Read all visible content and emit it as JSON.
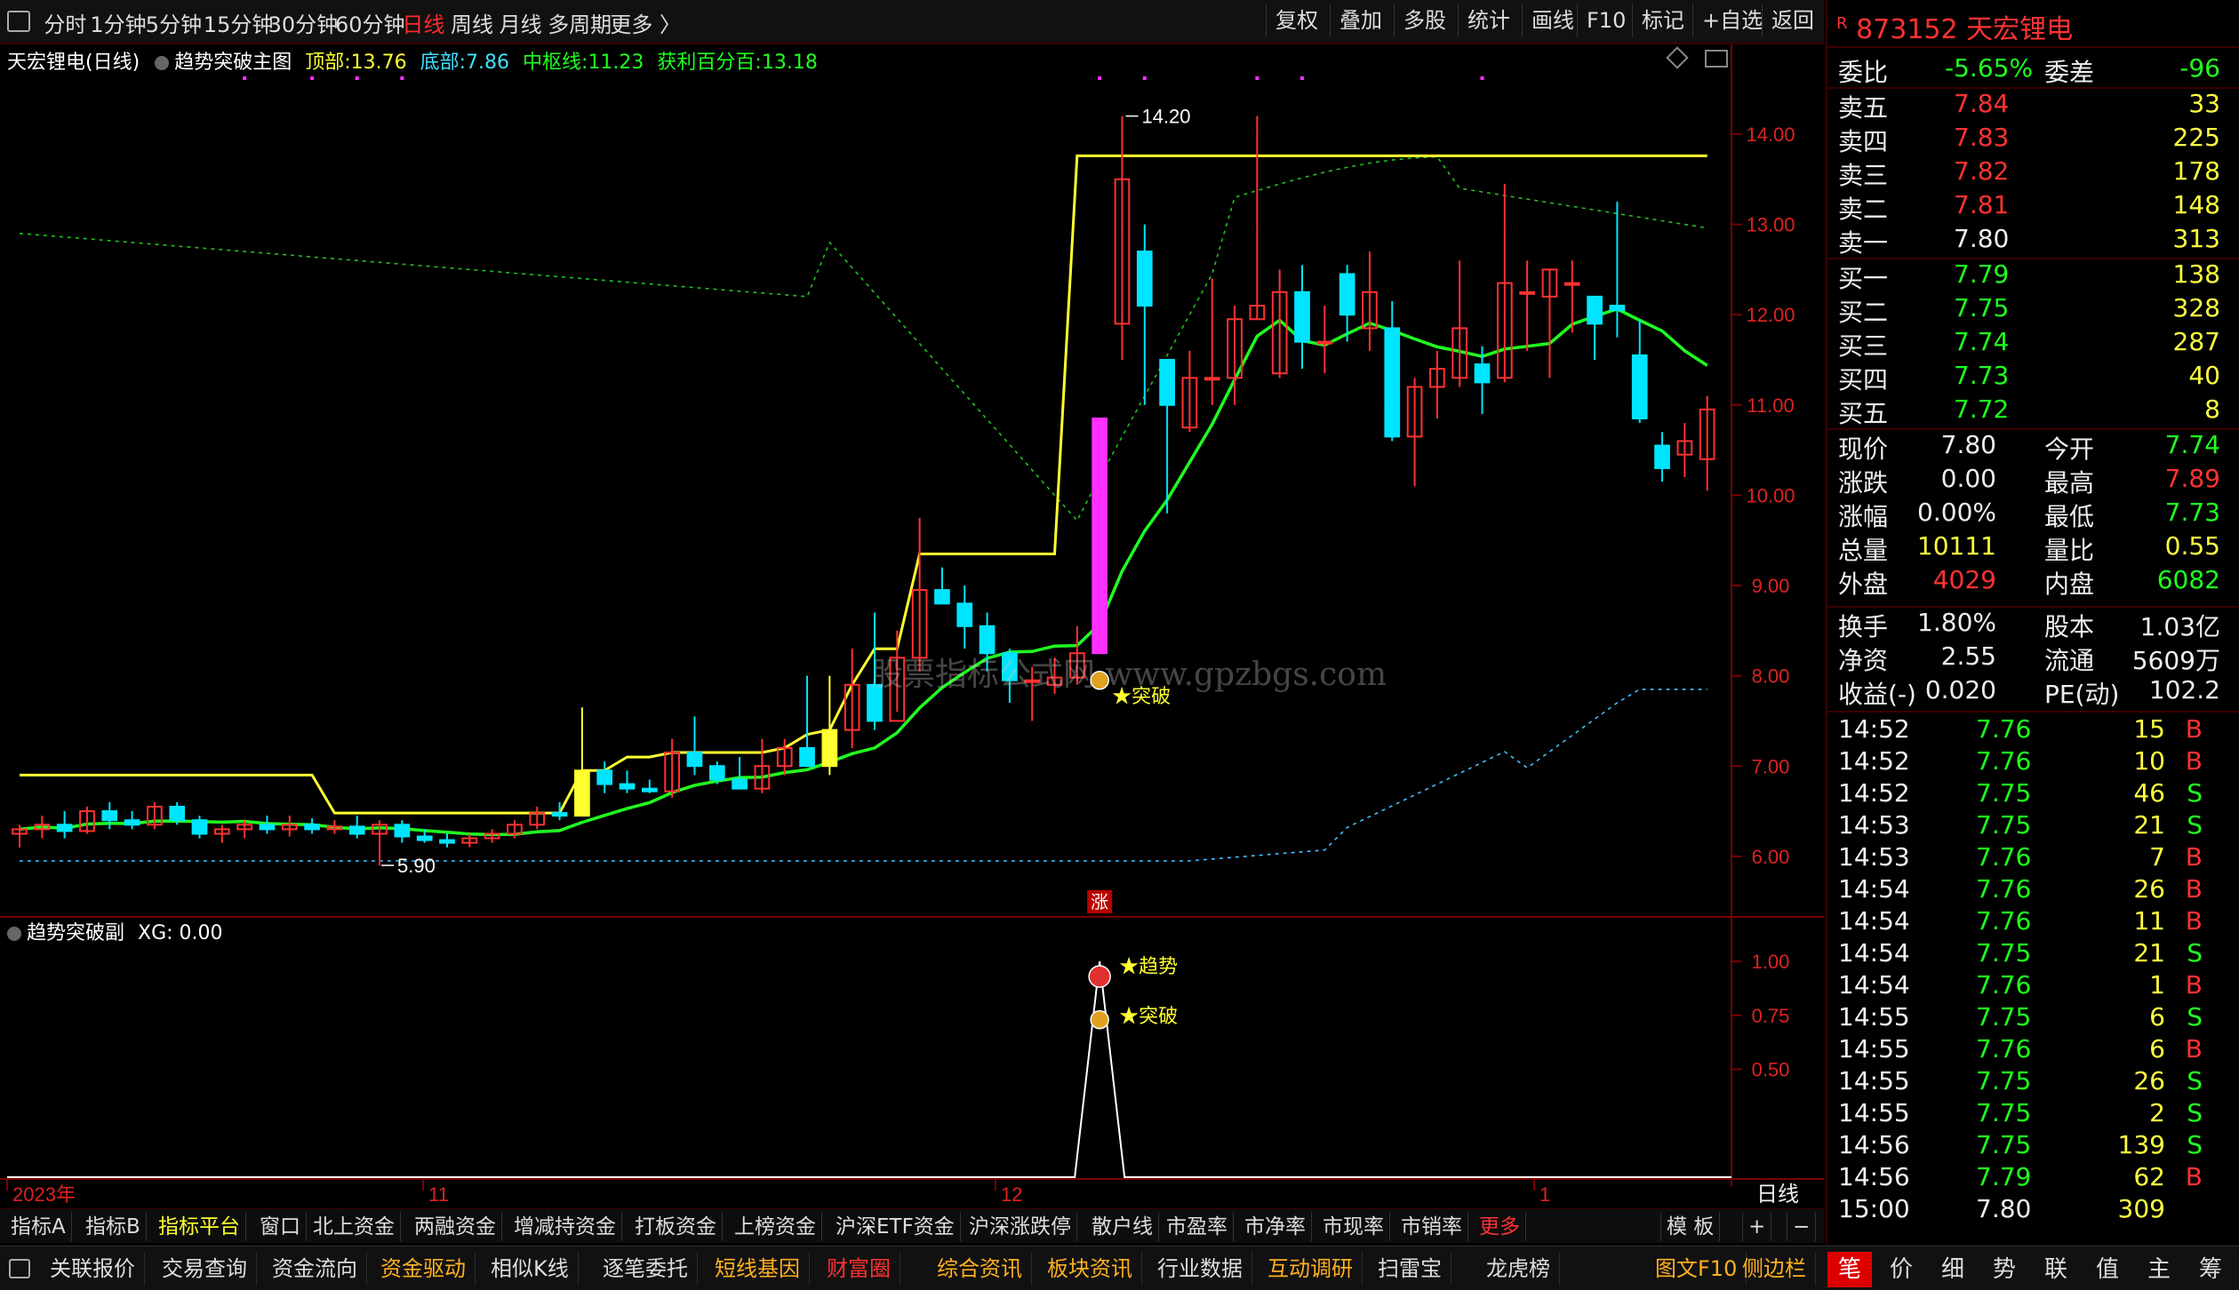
{
  "toolbar": {
    "left_items": [
      "分时",
      "1分钟",
      "5分钟",
      "15分钟",
      "30分钟",
      "60分钟",
      "日线",
      "周线",
      "月线",
      "多周期",
      "更多 〉"
    ],
    "active": "日线",
    "right_items": [
      "复权",
      "叠加",
      "多股",
      "统计",
      "画线",
      "F10",
      "标记",
      "+自选",
      "返回"
    ]
  },
  "main_legend": {
    "stock": "天宏锂电",
    "period": "(日线)",
    "indicator": "趋势突破主图",
    "top_label": "顶部:",
    "top_val": "13.76",
    "bottom_label": "底部:",
    "bottom_val": "7.86",
    "mid_label": "中枢线:",
    "mid_val": "11.23",
    "profit_label": "获利百分百:",
    "profit_val": "13.18"
  },
  "sub_legend": {
    "indicator": "趋势突破副",
    "xg": "XG: 0.00"
  },
  "annotations": {
    "high": "14.20",
    "low": "5.90",
    "breakout": "★突破",
    "trend": "★趋势",
    "breakout2": "★突破",
    "limit_up": "涨",
    "watermark": "股票指标公式网 www.gpzbgs.com"
  },
  "colors": {
    "up": "#ff3232",
    "down": "#00e5ff",
    "yellow_line": "#ffff30",
    "green_line": "#20ff20",
    "magenta": "#ff30ff"
  },
  "chart_data": {
    "type": "candlestick",
    "price_axis": [
      "14.00",
      "13.00",
      "12.00",
      "11.00",
      "10.00",
      "9.00",
      "8.00",
      "7.00",
      "6.00"
    ],
    "ylim": [
      5.3,
      14.6
    ],
    "sub_axis": [
      "1.00",
      "0.75",
      "0.50"
    ],
    "x_labels": [
      "2023年",
      "11",
      "12",
      "1"
    ],
    "period_label": "日线",
    "candles": [
      {
        "o": 6.25,
        "h": 6.35,
        "l": 6.1,
        "c": 6.3
      },
      {
        "o": 6.3,
        "h": 6.45,
        "l": 6.2,
        "c": 6.35
      },
      {
        "o": 6.35,
        "h": 6.5,
        "l": 6.2,
        "c": 6.28
      },
      {
        "o": 6.28,
        "h": 6.55,
        "l": 6.25,
        "c": 6.5
      },
      {
        "o": 6.5,
        "h": 6.6,
        "l": 6.3,
        "c": 6.4
      },
      {
        "o": 6.4,
        "h": 6.5,
        "l": 6.3,
        "c": 6.35
      },
      {
        "o": 6.35,
        "h": 6.6,
        "l": 6.3,
        "c": 6.55
      },
      {
        "o": 6.55,
        "h": 6.6,
        "l": 6.35,
        "c": 6.4
      },
      {
        "o": 6.4,
        "h": 6.45,
        "l": 6.2,
        "c": 6.25
      },
      {
        "o": 6.25,
        "h": 6.35,
        "l": 6.15,
        "c": 6.3
      },
      {
        "o": 6.3,
        "h": 6.4,
        "l": 6.2,
        "c": 6.35
      },
      {
        "o": 6.35,
        "h": 6.45,
        "l": 6.25,
        "c": 6.3
      },
      {
        "o": 6.3,
        "h": 6.45,
        "l": 6.22,
        "c": 6.35
      },
      {
        "o": 6.35,
        "h": 6.42,
        "l": 6.25,
        "c": 6.3
      },
      {
        "o": 6.3,
        "h": 6.4,
        "l": 6.25,
        "c": 6.33
      },
      {
        "o": 6.33,
        "h": 6.45,
        "l": 6.2,
        "c": 6.25
      },
      {
        "o": 6.25,
        "h": 6.4,
        "l": 5.9,
        "c": 6.35
      },
      {
        "o": 6.35,
        "h": 6.4,
        "l": 6.15,
        "c": 6.22
      },
      {
        "o": 6.22,
        "h": 6.3,
        "l": 6.15,
        "c": 6.18
      },
      {
        "o": 6.18,
        "h": 6.25,
        "l": 6.1,
        "c": 6.15
      },
      {
        "o": 6.15,
        "h": 6.25,
        "l": 6.1,
        "c": 6.2
      },
      {
        "o": 6.2,
        "h": 6.3,
        "l": 6.15,
        "c": 6.25
      },
      {
        "o": 6.25,
        "h": 6.4,
        "l": 6.2,
        "c": 6.35
      },
      {
        "o": 6.35,
        "h": 6.55,
        "l": 6.3,
        "c": 6.48
      },
      {
        "o": 6.48,
        "h": 6.6,
        "l": 6.4,
        "c": 6.45
      },
      {
        "o": 6.45,
        "h": 7.65,
        "l": 6.45,
        "c": 6.95
      },
      {
        "o": 6.95,
        "h": 7.05,
        "l": 6.7,
        "c": 6.8
      },
      {
        "o": 6.8,
        "h": 6.95,
        "l": 6.7,
        "c": 6.75
      },
      {
        "o": 6.75,
        "h": 6.85,
        "l": 6.7,
        "c": 6.72
      },
      {
        "o": 6.72,
        "h": 7.3,
        "l": 6.65,
        "c": 7.15
      },
      {
        "o": 7.15,
        "h": 7.55,
        "l": 6.9,
        "c": 7.0
      },
      {
        "o": 7.0,
        "h": 7.05,
        "l": 6.8,
        "c": 6.85
      },
      {
        "o": 6.85,
        "h": 7.1,
        "l": 6.75,
        "c": 6.75
      },
      {
        "o": 6.75,
        "h": 7.3,
        "l": 6.7,
        "c": 7.0
      },
      {
        "o": 7.0,
        "h": 7.3,
        "l": 6.9,
        "c": 7.2
      },
      {
        "o": 7.2,
        "h": 8.0,
        "l": 7.1,
        "c": 7.0
      },
      {
        "o": 7.0,
        "h": 8.0,
        "l": 6.9,
        "c": 7.4
      },
      {
        "o": 7.4,
        "h": 8.3,
        "l": 7.2,
        "c": 7.9
      },
      {
        "o": 7.9,
        "h": 8.7,
        "l": 7.4,
        "c": 7.5
      },
      {
        "o": 7.5,
        "h": 8.5,
        "l": 7.6,
        "c": 8.2
      },
      {
        "o": 8.2,
        "h": 9.75,
        "l": 8.05,
        "c": 8.95
      },
      {
        "o": 8.95,
        "h": 9.2,
        "l": 8.8,
        "c": 8.8
      },
      {
        "o": 8.8,
        "h": 9.0,
        "l": 8.3,
        "c": 8.55
      },
      {
        "o": 8.55,
        "h": 8.7,
        "l": 8.05,
        "c": 8.25
      },
      {
        "o": 8.25,
        "h": 8.3,
        "l": 7.7,
        "c": 7.95
      },
      {
        "o": 7.95,
        "h": 8.1,
        "l": 7.5,
        "c": 7.95
      },
      {
        "o": 7.9,
        "h": 8.2,
        "l": 7.8,
        "c": 7.98
      },
      {
        "o": 7.98,
        "h": 8.55,
        "l": 7.9,
        "c": 8.25
      },
      {
        "o": 8.25,
        "h": 10.85,
        "l": 8.25,
        "c": 10.85
      },
      {
        "o": 11.9,
        "h": 14.2,
        "l": 11.5,
        "c": 13.5
      },
      {
        "o": 12.7,
        "h": 13.0,
        "l": 11.0,
        "c": 12.1
      },
      {
        "o": 11.5,
        "h": 11.0,
        "l": 9.8,
        "c": 11.0
      },
      {
        "o": 10.75,
        "h": 11.6,
        "l": 10.7,
        "c": 11.3
      },
      {
        "o": 11.3,
        "h": 12.4,
        "l": 11.0,
        "c": 11.3
      },
      {
        "o": 11.3,
        "h": 12.1,
        "l": 11.0,
        "c": 11.95
      },
      {
        "o": 11.95,
        "h": 14.2,
        "l": 11.95,
        "c": 12.1
      },
      {
        "o": 11.35,
        "h": 12.5,
        "l": 11.3,
        "c": 12.25
      },
      {
        "o": 12.25,
        "h": 12.55,
        "l": 11.4,
        "c": 11.7
      },
      {
        "o": 11.7,
        "h": 12.1,
        "l": 11.35,
        "c": 11.7
      },
      {
        "o": 12.45,
        "h": 12.55,
        "l": 11.7,
        "c": 12.0
      },
      {
        "o": 11.85,
        "h": 12.7,
        "l": 11.6,
        "c": 12.25
      },
      {
        "o": 11.85,
        "h": 12.15,
        "l": 10.6,
        "c": 10.65
      },
      {
        "o": 10.65,
        "h": 11.3,
        "l": 10.1,
        "c": 11.2
      },
      {
        "o": 11.2,
        "h": 11.6,
        "l": 10.85,
        "c": 11.4
      },
      {
        "o": 11.3,
        "h": 12.6,
        "l": 11.2,
        "c": 11.85
      },
      {
        "o": 11.45,
        "h": 11.65,
        "l": 10.9,
        "c": 11.25
      },
      {
        "o": 11.3,
        "h": 13.45,
        "l": 11.25,
        "c": 12.35
      },
      {
        "o": 12.25,
        "h": 12.6,
        "l": 11.6,
        "c": 12.25
      },
      {
        "o": 12.2,
        "h": 12.5,
        "l": 11.3,
        "c": 12.5
      },
      {
        "o": 12.35,
        "h": 12.6,
        "l": 11.8,
        "c": 12.35
      },
      {
        "o": 12.2,
        "h": 12.2,
        "l": 11.5,
        "c": 11.9
      },
      {
        "o": 12.1,
        "h": 13.25,
        "l": 11.75,
        "c": 12.05
      },
      {
        "o": 11.55,
        "h": 11.95,
        "l": 10.8,
        "c": 10.85
      },
      {
        "o": 10.55,
        "h": 10.7,
        "l": 10.15,
        "c": 10.3
      },
      {
        "o": 10.45,
        "h": 10.8,
        "l": 10.2,
        "c": 10.6
      },
      {
        "o": 10.4,
        "h": 11.1,
        "l": 10.05,
        "c": 10.95
      }
    ]
  },
  "quote": {
    "code_prefix": "R",
    "code": "873152",
    "name": "天宏锂电",
    "ratio_label": "委比",
    "ratio": "-5.65%",
    "diff_label": "委差",
    "diff": "-96",
    "asks": [
      {
        "label": "卖五",
        "price": "7.84",
        "vol": "33"
      },
      {
        "label": "卖四",
        "price": "7.83",
        "vol": "225"
      },
      {
        "label": "卖三",
        "price": "7.82",
        "vol": "178"
      },
      {
        "label": "卖二",
        "price": "7.81",
        "vol": "148"
      },
      {
        "label": "卖一",
        "price": "7.80",
        "vol": "313"
      }
    ],
    "bids": [
      {
        "label": "买一",
        "price": "7.79",
        "vol": "138"
      },
      {
        "label": "买二",
        "price": "7.75",
        "vol": "328"
      },
      {
        "label": "买三",
        "price": "7.74",
        "vol": "287"
      },
      {
        "label": "买四",
        "price": "7.73",
        "vol": "40"
      },
      {
        "label": "买五",
        "price": "7.72",
        "vol": "8"
      }
    ],
    "stats": [
      {
        "k1": "现价",
        "v1": "7.80",
        "c1": "white",
        "k2": "今开",
        "v2": "7.74",
        "c2": "green"
      },
      {
        "k1": "涨跌",
        "v1": "0.00",
        "c1": "white",
        "k2": "最高",
        "v2": "7.89",
        "c2": "red"
      },
      {
        "k1": "涨幅",
        "v1": "0.00%",
        "c1": "white",
        "k2": "最低",
        "v2": "7.73",
        "c2": "green"
      },
      {
        "k1": "总量",
        "v1": "10111",
        "c1": "yellow",
        "k2": "量比",
        "v2": "0.55",
        "c2": "yellow"
      },
      {
        "k1": "外盘",
        "v1": "4029",
        "c1": "red",
        "k2": "内盘",
        "v2": "6082",
        "c2": "green"
      }
    ],
    "stats2": [
      {
        "k1": "换手",
        "v1": "1.80%",
        "k2": "股本",
        "v2": "1.03亿"
      },
      {
        "k1": "净资",
        "v1": "2.55",
        "k2": "流通",
        "v2": "5609万"
      },
      {
        "k1": "收益(-)",
        "v1": "0.020",
        "k2": "PE(动)",
        "v2": "102.2"
      }
    ],
    "ticks": [
      {
        "t": "14:52",
        "p": "7.76",
        "v": "15",
        "s": "B"
      },
      {
        "t": "14:52",
        "p": "7.76",
        "v": "10",
        "s": "B"
      },
      {
        "t": "14:52",
        "p": "7.75",
        "v": "46",
        "s": "S"
      },
      {
        "t": "14:53",
        "p": "7.75",
        "v": "21",
        "s": "S"
      },
      {
        "t": "14:53",
        "p": "7.76",
        "v": "7",
        "s": "B"
      },
      {
        "t": "14:54",
        "p": "7.76",
        "v": "26",
        "s": "B"
      },
      {
        "t": "14:54",
        "p": "7.76",
        "v": "11",
        "s": "B"
      },
      {
        "t": "14:54",
        "p": "7.75",
        "v": "21",
        "s": "S"
      },
      {
        "t": "14:54",
        "p": "7.76",
        "v": "1",
        "s": "B"
      },
      {
        "t": "14:55",
        "p": "7.75",
        "v": "6",
        "s": "S"
      },
      {
        "t": "14:55",
        "p": "7.76",
        "v": "6",
        "s": "B"
      },
      {
        "t": "14:55",
        "p": "7.75",
        "v": "26",
        "s": "S"
      },
      {
        "t": "14:55",
        "p": "7.75",
        "v": "2",
        "s": "S"
      },
      {
        "t": "14:56",
        "p": "7.75",
        "v": "139",
        "s": "S"
      },
      {
        "t": "14:56",
        "p": "7.79",
        "v": "62",
        "s": "B"
      },
      {
        "t": "15:00",
        "p": "7.80",
        "v": "309",
        "s": ""
      }
    ]
  },
  "indicator_tabs": {
    "items": [
      "指标A",
      "指标B",
      "指标平台",
      "窗口",
      "北上资金",
      "两融资金",
      "增减持资金",
      "打板资金",
      "上榜资金",
      "沪深ETF资金",
      "沪深涨跌停",
      "散户线",
      "市盈率",
      "市净率",
      "市现率",
      "市销率",
      "更多"
    ],
    "right": [
      "模 板",
      "+",
      "−"
    ]
  },
  "bottom_tabs": {
    "items": [
      "关联报价",
      "交易查询",
      "资金流向",
      "资金驱动",
      "相似K线",
      "逐笔委托",
      "短线基因",
      "财富圈",
      "综合资讯",
      "板块资讯",
      "行业数据",
      "互动调研",
      "扫雷宝",
      "龙虎榜",
      "图文F10",
      "侧边栏"
    ],
    "right": [
      "笔",
      "价",
      "细",
      "势",
      "联",
      "值",
      "主",
      "筹"
    ]
  }
}
